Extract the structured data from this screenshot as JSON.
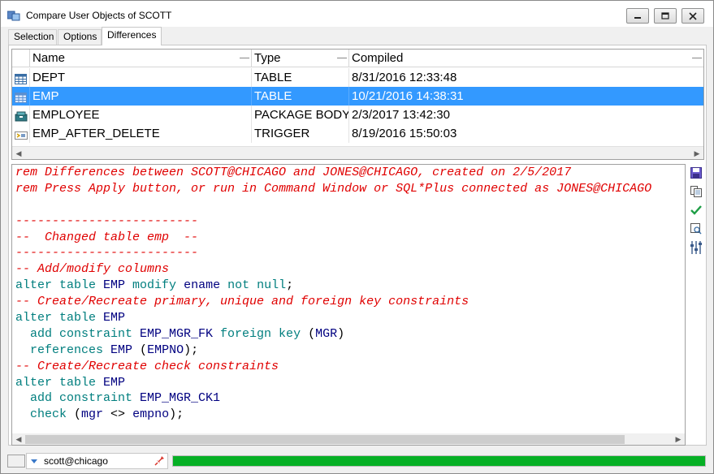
{
  "window": {
    "title": "Compare User Objects of SCOTT",
    "controls": {
      "minimize": "minimize-icon",
      "maximize": "maximize-icon",
      "close": "close-icon"
    }
  },
  "tabs": [
    {
      "label": "Selection",
      "active": false
    },
    {
      "label": "Options",
      "active": false
    },
    {
      "label": "Differences",
      "active": true
    }
  ],
  "grid": {
    "columns": [
      "Name",
      "Type",
      "Compiled"
    ],
    "rows": [
      {
        "icon": "table-icon",
        "name": "DEPT",
        "type": "TABLE",
        "compiled": "8/31/2016 12:33:48",
        "selected": false
      },
      {
        "icon": "table-icon",
        "name": "EMP",
        "type": "TABLE",
        "compiled": "10/21/2016 14:38:31",
        "selected": true
      },
      {
        "icon": "package-body-icon",
        "name": "EMPLOYEE",
        "type": "PACKAGE BODY",
        "compiled": "2/3/2017 13:42:30",
        "selected": false
      },
      {
        "icon": "trigger-icon",
        "name": "EMP_AFTER_DELETE",
        "type": "TRIGGER",
        "compiled": "8/19/2016 15:50:03",
        "selected": false
      }
    ]
  },
  "editor": {
    "lines": [
      [
        {
          "t": "rem Differences between SCOTT@CHICAGO and JONES@CHICAGO, created on 2/5/2017",
          "c": "cm"
        }
      ],
      [
        {
          "t": "rem Press Apply button, or run in Command Window or SQL*Plus connected as JONES@CHICAGO",
          "c": "cm"
        }
      ],
      [
        {
          "t": "",
          "c": "pl"
        }
      ],
      [
        {
          "t": "-------------------------",
          "c": "cm"
        }
      ],
      [
        {
          "t": "--  Changed table emp  --",
          "c": "cm"
        }
      ],
      [
        {
          "t": "-------------------------",
          "c": "cm"
        }
      ],
      [
        {
          "t": "-- Add/modify columns",
          "c": "cm"
        }
      ],
      [
        {
          "t": "alter table ",
          "c": "kw"
        },
        {
          "t": "EMP",
          "c": "id"
        },
        {
          "t": " modify ",
          "c": "kw"
        },
        {
          "t": "ename",
          "c": "id"
        },
        {
          "t": " not null",
          "c": "kw"
        },
        {
          "t": ";",
          "c": "pl"
        }
      ],
      [
        {
          "t": "-- Create/Recreate primary, unique and foreign key constraints",
          "c": "cm"
        }
      ],
      [
        {
          "t": "alter table ",
          "c": "kw"
        },
        {
          "t": "EMP",
          "c": "id"
        }
      ],
      [
        {
          "t": "  add constraint ",
          "c": "kw"
        },
        {
          "t": "EMP_MGR_FK",
          "c": "id"
        },
        {
          "t": " foreign key ",
          "c": "kw"
        },
        {
          "t": "(",
          "c": "pl"
        },
        {
          "t": "MGR",
          "c": "id"
        },
        {
          "t": ")",
          "c": "pl"
        }
      ],
      [
        {
          "t": "  references ",
          "c": "kw"
        },
        {
          "t": "EMP",
          "c": "id"
        },
        {
          "t": " (",
          "c": "pl"
        },
        {
          "t": "EMPNO",
          "c": "id"
        },
        {
          "t": ");",
          "c": "pl"
        }
      ],
      [
        {
          "t": "-- Create/Recreate check constraints",
          "c": "cm"
        }
      ],
      [
        {
          "t": "alter table ",
          "c": "kw"
        },
        {
          "t": "EMP",
          "c": "id"
        }
      ],
      [
        {
          "t": "  add constraint ",
          "c": "kw"
        },
        {
          "t": "EMP_MGR_CK1",
          "c": "id"
        }
      ],
      [
        {
          "t": "  check ",
          "c": "kw"
        },
        {
          "t": "(",
          "c": "pl"
        },
        {
          "t": "mgr",
          "c": "id"
        },
        {
          "t": " <> ",
          "c": "pl"
        },
        {
          "t": "empno",
          "c": "id"
        },
        {
          "t": ");",
          "c": "pl"
        }
      ]
    ]
  },
  "side_buttons": [
    {
      "icon": "save-icon"
    },
    {
      "icon": "copy-icon"
    },
    {
      "icon": "apply-check-icon"
    },
    {
      "icon": "find-icon"
    },
    {
      "icon": "settings-sliders-icon"
    }
  ],
  "statusbar": {
    "connection": "scott@chicago",
    "progress": 1.0
  },
  "colors": {
    "selection": "#3399ff",
    "comment": "#e00000",
    "keyword": "#007e7e",
    "identifier": "#000080",
    "progress": "#06b025"
  }
}
